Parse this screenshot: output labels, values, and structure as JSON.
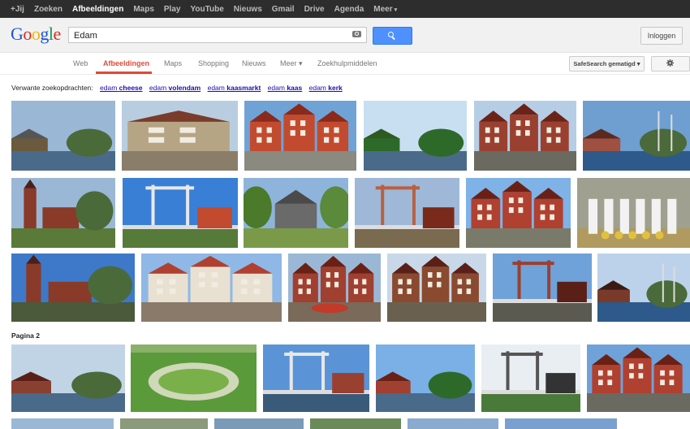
{
  "topbar": {
    "items": [
      {
        "label": "+Jij",
        "active": false
      },
      {
        "label": "Zoeken",
        "active": false
      },
      {
        "label": "Afbeeldingen",
        "active": true
      },
      {
        "label": "Maps",
        "active": false
      },
      {
        "label": "Play",
        "active": false
      },
      {
        "label": "YouTube",
        "active": false
      },
      {
        "label": "Nieuws",
        "active": false
      },
      {
        "label": "Gmail",
        "active": false
      },
      {
        "label": "Drive",
        "active": false
      },
      {
        "label": "Agenda",
        "active": false
      },
      {
        "label": "Meer",
        "active": false
      }
    ]
  },
  "header": {
    "logo": "Google",
    "search_value": "Edam",
    "login_label": "Inloggen"
  },
  "tabs": {
    "items": [
      {
        "label": "Web"
      },
      {
        "label": "Afbeeldingen"
      },
      {
        "label": "Maps"
      },
      {
        "label": "Shopping"
      },
      {
        "label": "Nieuws"
      },
      {
        "label": "Meer ▾"
      },
      {
        "label": "Zoekhulpmiddelen"
      }
    ],
    "safesearch_label": "SafeSearch gematigd ▾"
  },
  "related": {
    "prefix": "Verwante zoekopdrachten:",
    "links": [
      {
        "base": "edam",
        "term": "cheese"
      },
      {
        "base": "edam",
        "term": "volendam"
      },
      {
        "base": "edam",
        "term": "kaasmarkt"
      },
      {
        "base": "edam",
        "term": "kaas"
      },
      {
        "base": "edam",
        "term": "kerk"
      }
    ]
  },
  "pagina_label": "Pagina 2",
  "colors": {
    "accent": "#dd4b39",
    "link": "#1a0dab",
    "search_button": "#4d90fe"
  }
}
